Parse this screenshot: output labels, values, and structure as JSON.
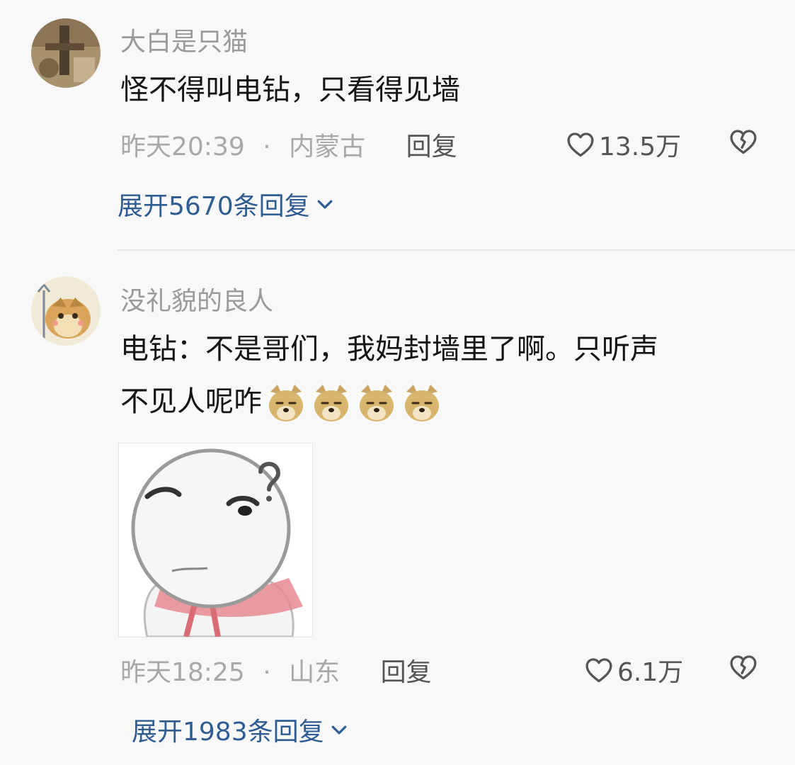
{
  "comments": [
    {
      "username": "大白是只猫",
      "text": "怪不得叫电钻，只看得见墙",
      "time": "昨天20:39",
      "separator": "·",
      "location": "内蒙古",
      "reply_label": "回复",
      "likes": "13.5万",
      "expand_label": "展开5670条回复"
    },
    {
      "username": "没礼貌的良人",
      "text_line1": "电钻：不是哥们，我妈封墙里了啊。只听声",
      "text_line2": "不见人呢咋",
      "time": "昨天18:25",
      "separator": "·",
      "location": "山东",
      "reply_label": "回复",
      "likes": "6.1万",
      "expand_label": "展开1983条回复"
    }
  ],
  "icons": {
    "like": "heart-outline-icon",
    "dislike": "broken-heart-icon",
    "expand": "chevron-down-icon",
    "emoji": "doge-emoji-icon"
  },
  "colors": {
    "link": "#2f5d92",
    "meta": "#a8a8a8",
    "text": "#151515",
    "background": "#f8f8f8"
  }
}
